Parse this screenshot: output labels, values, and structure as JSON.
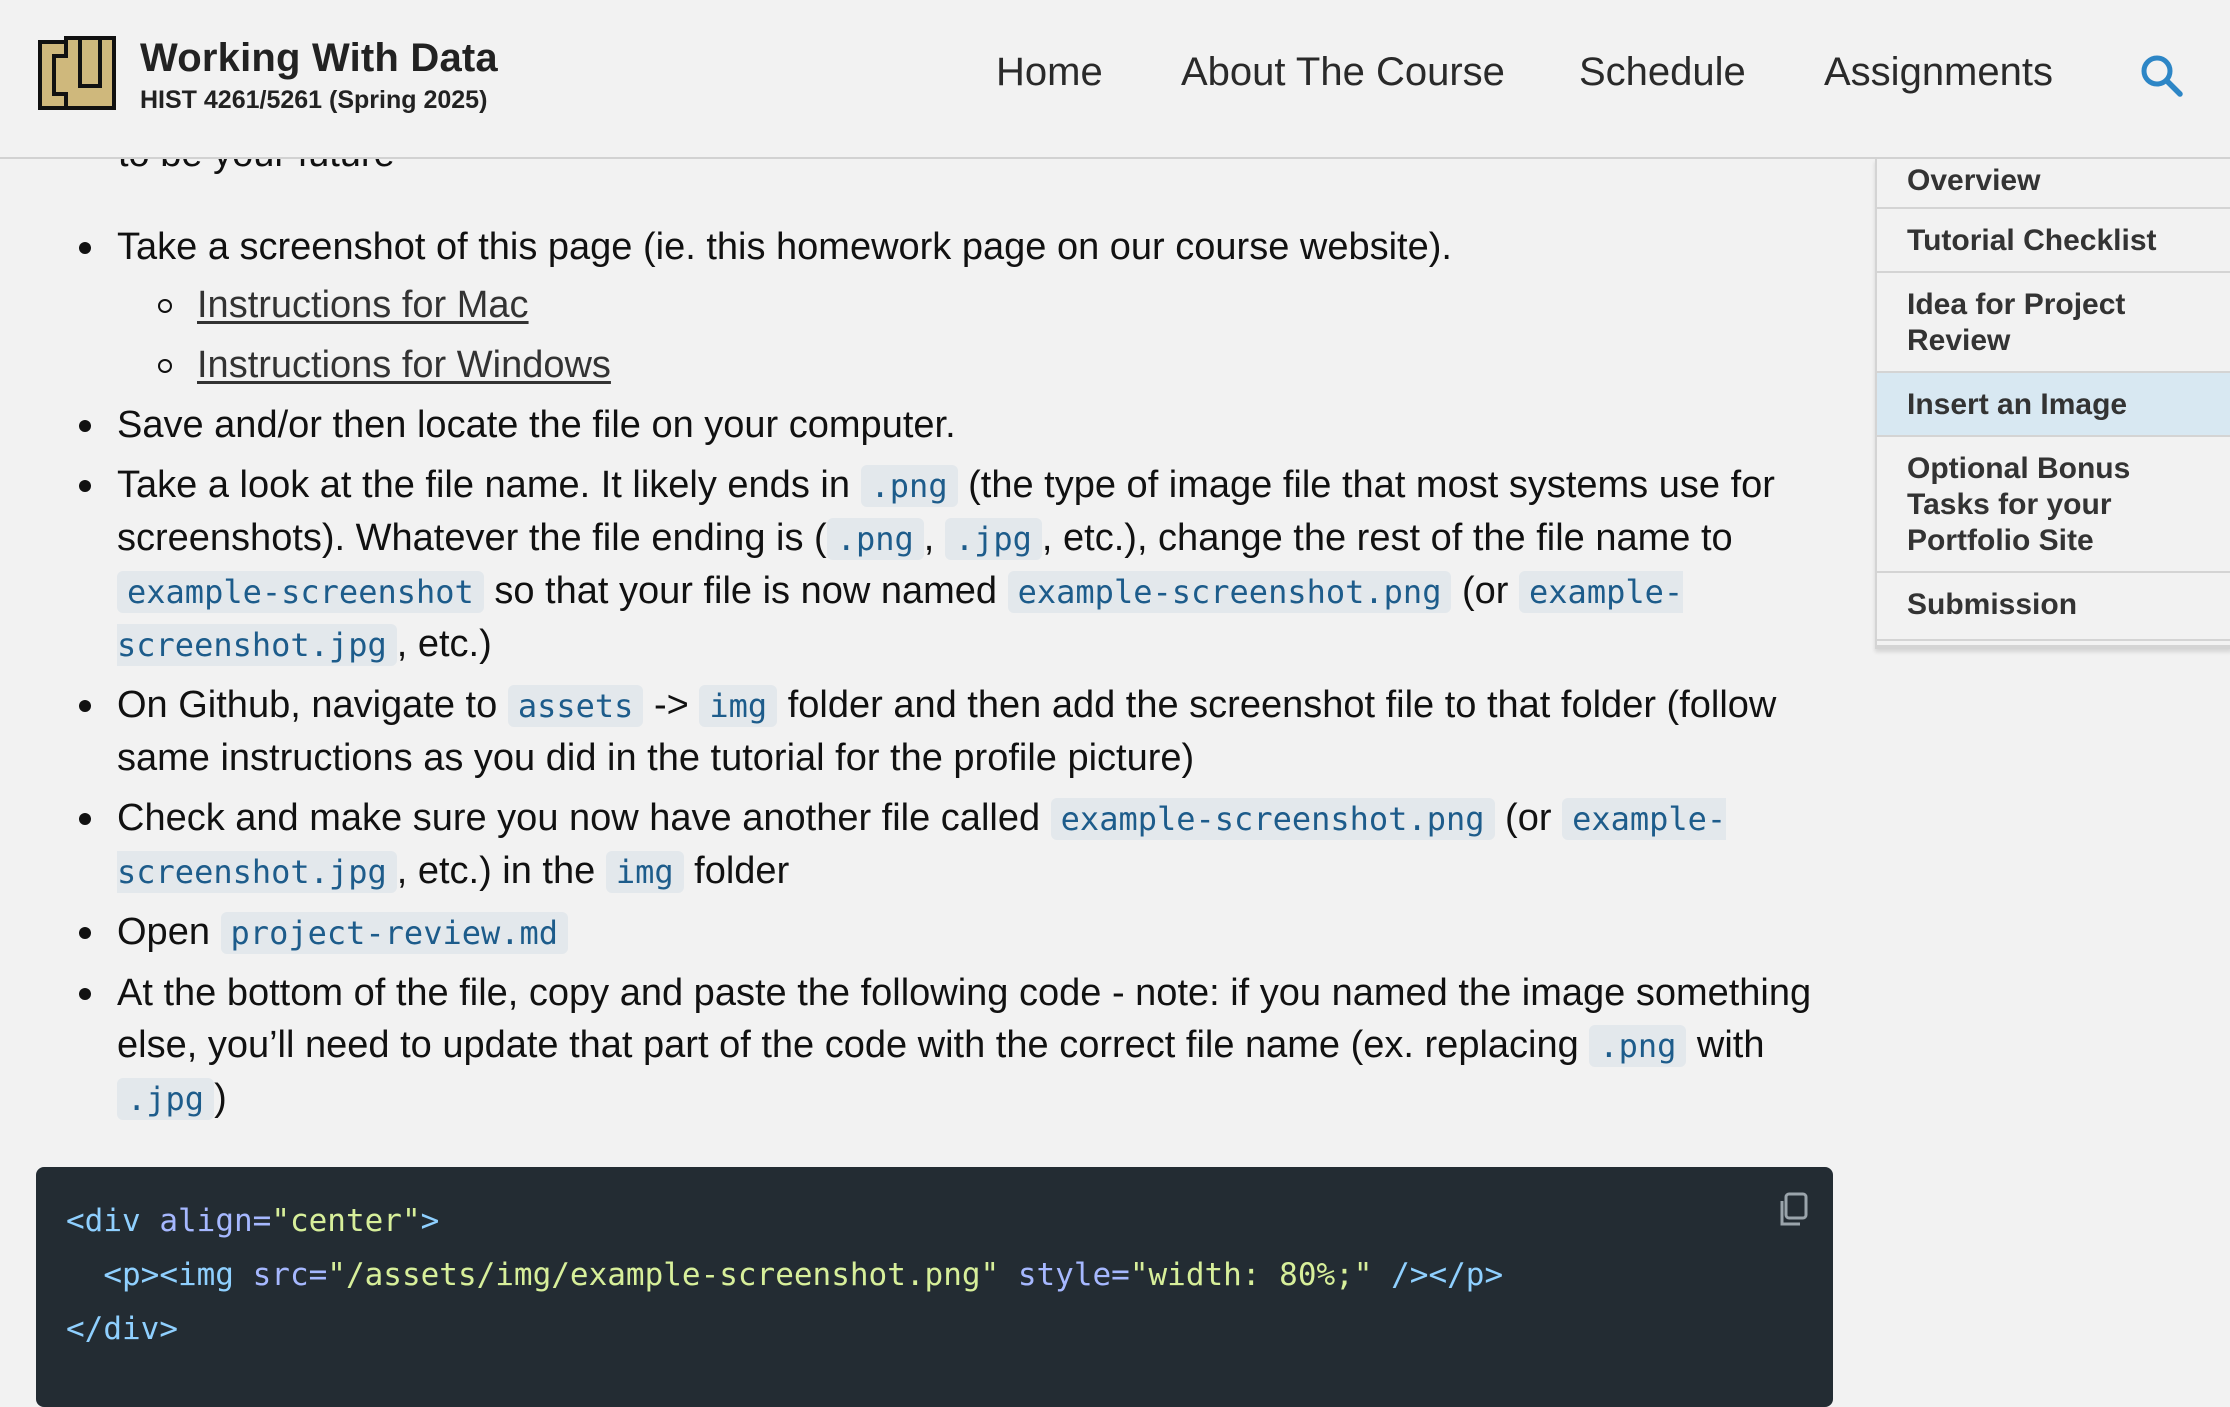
{
  "header": {
    "site_title": "Working With Data",
    "site_subtitle": "HIST 4261/5261 (Spring 2025)",
    "nav": [
      "Home",
      "About The Course",
      "Schedule",
      "Assignments"
    ]
  },
  "content": {
    "clipped_text": "to be your future",
    "bullets": {
      "b1": "Take a screenshot of this page (ie. this homework page on our course website).",
      "sub_mac": "Instructions for Mac",
      "sub_windows": "Instructions for Windows",
      "b2": "Save and/or then locate the file on your computer.",
      "b3_part1": "Take a look at the file name. It likely ends in ",
      "b3_code1": ".png",
      "b3_part2": " (the type of image file that most systems use for screenshots). Whatever the file ending is (",
      "b3_code2": ".png",
      "b3_part3": ", ",
      "b3_code3": ".jpg",
      "b3_part4": ", etc.), change the rest of the file name to ",
      "b3_code4": "example-screenshot",
      "b3_part5": " so that your file is now named ",
      "b3_code5": "example-screenshot.png",
      "b3_part6": " (or ",
      "b3_code6": "example-screenshot.jpg",
      "b3_part7": ", etc.)",
      "b4_part1": "On Github, navigate to ",
      "b4_code1": "assets",
      "b4_part2": " -> ",
      "b4_code2": "img",
      "b4_part3": " folder and then add the screenshot file to that folder (follow same instructions as you did in the tutorial for the profile picture)",
      "b5_part1": "Check and make sure you now have another file called ",
      "b5_code1": "example-screenshot.png",
      "b5_part2": " (or ",
      "b5_code2": "example-screenshot.jpg",
      "b5_part3": ", etc.) in the ",
      "b5_code3": "img",
      "b5_part4": " folder",
      "b6_part1": "Open ",
      "b6_code1": "project-review.md",
      "b7_part1": "At the bottom of the file, copy and paste the following code - note: if you named the image something else, you’ll need to update that part of the code with the correct file name (ex. replacing ",
      "b7_code1": ".png",
      "b7_part2": " with ",
      "b7_code2": ".jpg",
      "b7_part3": ")"
    },
    "code": {
      "l1_open": "<div ",
      "l1_attr": "align=",
      "l1_str": "\"center\"",
      "l1_close": ">",
      "l2_open": "  <p><img ",
      "l2_attr1": "src=",
      "l2_str1": "\"/assets/img/example-screenshot.png\"",
      "l2_attr2": " style=",
      "l2_str2": "\"width: 80%;\"",
      "l2_close": " /></p>",
      "l3": "</div>"
    }
  },
  "toc": {
    "items": [
      "Overview",
      "Tutorial Checklist",
      "Idea for Project Review",
      "Insert an Image",
      "Optional Bonus Tasks for your Portfolio Site",
      "Submission"
    ],
    "active": "Insert an Image"
  },
  "colors": {
    "background": "#f2f2f2",
    "inline_code_text": "#1d5c8b",
    "inline_code_bg": "#e3e8ec",
    "code_block_bg": "#232c33",
    "search_icon": "#2d86c6",
    "toc_active_bg": "#d8e8f2",
    "logo_gold": "#cfb87c"
  },
  "icons": [
    "cu-logo",
    "search-icon",
    "copy-icon"
  ]
}
